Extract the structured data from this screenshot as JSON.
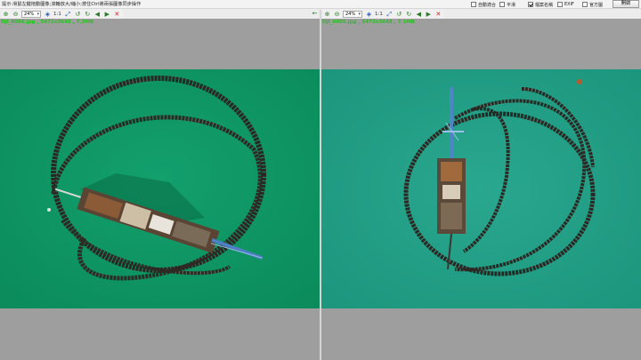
{
  "topbar": {
    "hint": "提示:滑鼠左鍵拖動圖像;滾輪放大/縮小;按住Ctrl將兩張圖像同步操作",
    "checkboxes": [
      {
        "label": "自動適合",
        "checked": false
      },
      {
        "label": "平滑",
        "checked": false
      },
      {
        "label": "檔案名稱",
        "checked": true
      },
      {
        "label": "EXIF",
        "checked": false
      },
      {
        "label": "官方圖",
        "checked": false
      }
    ],
    "open_button": "開啟"
  },
  "left_pane": {
    "zoom": "24%",
    "ratio_label": "1:1",
    "file_info": "DJI_0006.jpg , 5472x3648 , 7.3MB"
  },
  "right_pane": {
    "zoom": "24%",
    "ratio_label": "1:1",
    "file_info": "DJI_0005.jpg , 5472x3648 , 7.1MB"
  },
  "icons": {
    "zoom_in": "zoom-in-icon",
    "zoom_out": "zoom-out-icon",
    "fit": "fit-icon",
    "rotate_left": "rotate-left-icon",
    "rotate_right": "rotate-right-icon",
    "prev": "previous-icon",
    "next": "next-icon",
    "close": "close-icon"
  },
  "colors": {
    "water_left": "#0e9a66",
    "water_right": "#22a087",
    "pane_bg": "#9e9e9e",
    "file_info_text": "#26c21f"
  }
}
